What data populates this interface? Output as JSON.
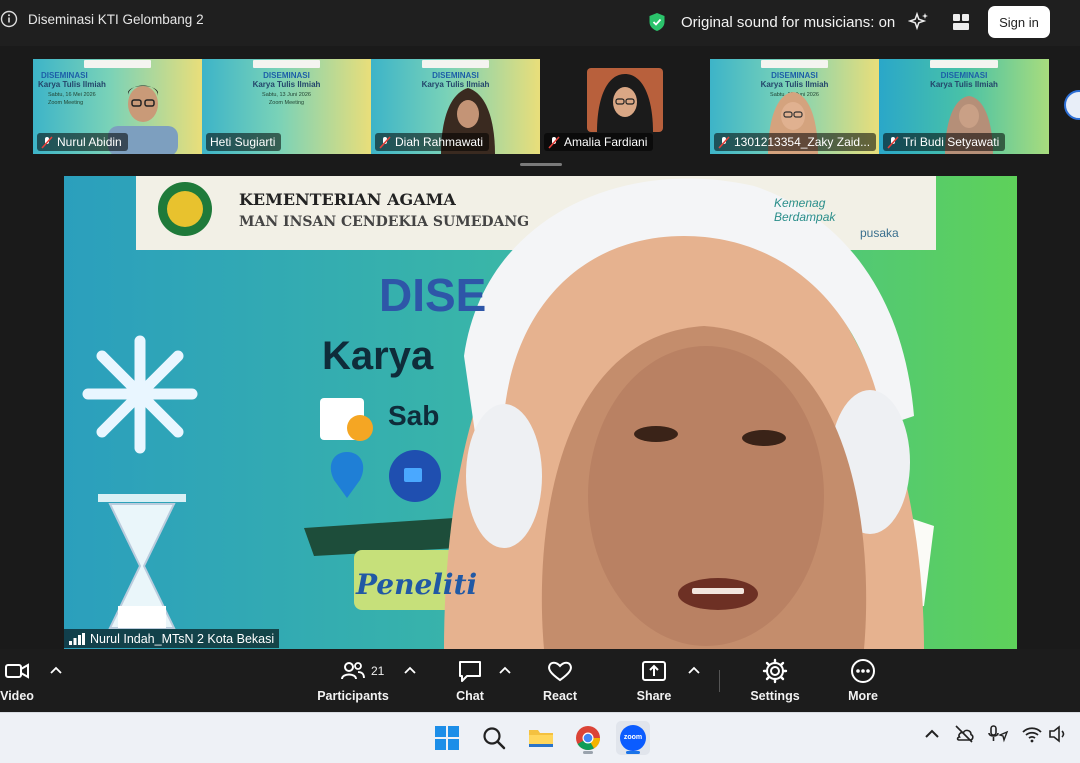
{
  "window": {
    "title": "Diseminasi KTI Gelombang 2",
    "audio_status": "Original sound for musicians: on",
    "sign_in_label": "Sign in",
    "shield_color": "#2bc36b"
  },
  "thumbnails": [
    {
      "name": "Nurul Abidin",
      "slide_title1": "DISEMINASI",
      "slide_title2": "Karya Tulis Ilmiah",
      "slide_date": "Sabtu, 16 Mei 2026",
      "slide_meeting": "Zoom Meeting"
    },
    {
      "name": "Heti Sugiarti",
      "slide_title1": "DISEMINASI",
      "slide_title2": "Karya Tulis Ilmiah",
      "slide_date": "Sabtu, 13 Juni 2026",
      "slide_meeting": "Zoom Meeting"
    },
    {
      "name": "Diah Rahmawati",
      "slide_title1": "DISEMINASI",
      "slide_title2": "Karya Tulis Ilmiah",
      "slide_date": "",
      "slide_meeting": ""
    },
    {
      "name": "Amalia Fardiani"
    },
    {
      "name": "1301213354_Zaky Zaid...",
      "slide_title1": "DISEMINASI",
      "slide_title2": "Karya Tulis Ilmiah",
      "slide_date": "Sabtu, 13 Juni 2026",
      "slide_meeting": ""
    },
    {
      "name": "Tri Budi Setyawati",
      "slide_title1": "DISEMINASI",
      "slide_title2": "Karya Tulis Ilmiah",
      "slide_date": "",
      "slide_meeting": ""
    }
  ],
  "main_video": {
    "speaker": "Nurul Indah_MTsN 2 Kota Bekasi",
    "banner_line1": "KEMENTERIAN AGAMA",
    "banner_line2": "MAN INSAN CENDEKIA SUMEDANG",
    "partner_text": "Kemenag Berdampak",
    "pusaka_text": "pusaka",
    "slide_title": "DISE",
    "slide_subtitle": "Karya",
    "slide_day": "Sab",
    "slide_footer": "Peneliti"
  },
  "controls": {
    "video_label": "Video",
    "participants_label": "Participants",
    "participants_count": "21",
    "chat_label": "Chat",
    "react_label": "React",
    "share_label": "Share",
    "settings_label": "Settings",
    "more_label": "More"
  },
  "taskbar": {
    "zoom_label": "zoom",
    "icons": [
      "windows-start-icon",
      "search-icon",
      "file-explorer-icon",
      "chrome-icon",
      "zoom-app-icon"
    ],
    "tray": [
      "chevron-up-icon",
      "cloud-offline-icon",
      "mic-location-icon",
      "wifi-icon",
      "volume-icon"
    ]
  }
}
